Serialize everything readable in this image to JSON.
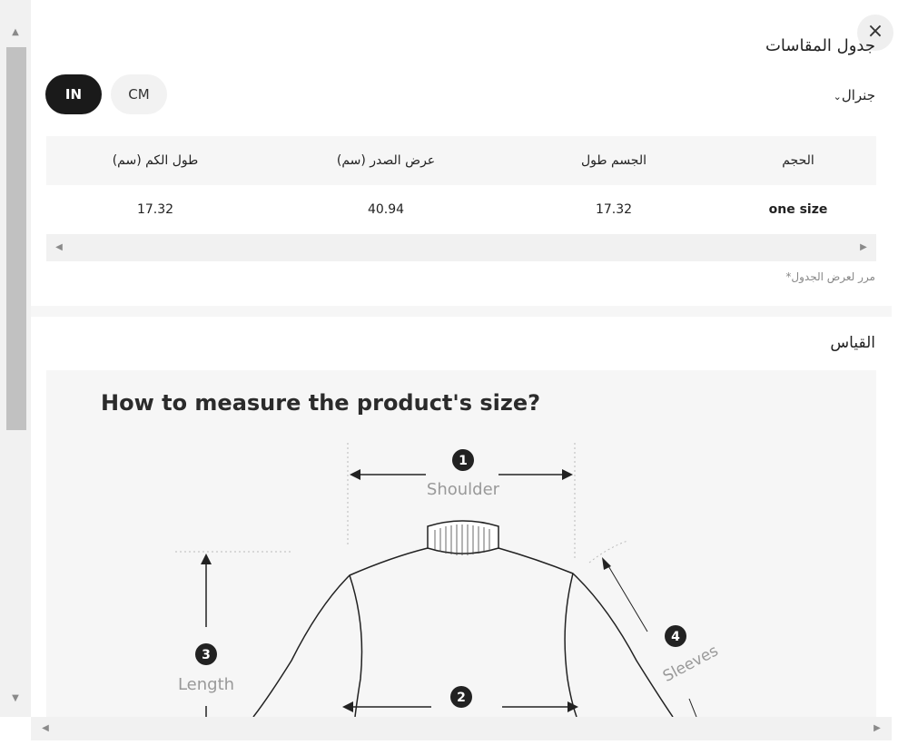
{
  "header": {
    "title": "جدول المقاسات",
    "close_icon": "×"
  },
  "units": {
    "in_label": "IN",
    "cm_label": "CM",
    "active": "IN"
  },
  "region": {
    "label": "جنرال",
    "chevron": "⌄"
  },
  "table": {
    "headers": [
      "طول الكم (سم)",
      "عرض الصدر (سم)",
      "الجسم طول",
      "الحجم"
    ],
    "rows": [
      [
        "17.32",
        "40.94",
        "17.32",
        "one size"
      ]
    ]
  },
  "scroll_note": "*مرر لعرض الجدول",
  "measurement": {
    "title": "القياس",
    "heading": "How to measure the product's size?",
    "labels": {
      "num1": "1",
      "shoulder": "Shoulder",
      "num2": "2",
      "num3": "3",
      "length": "Length",
      "num4": "4",
      "sleeves": "Sleeves"
    }
  }
}
